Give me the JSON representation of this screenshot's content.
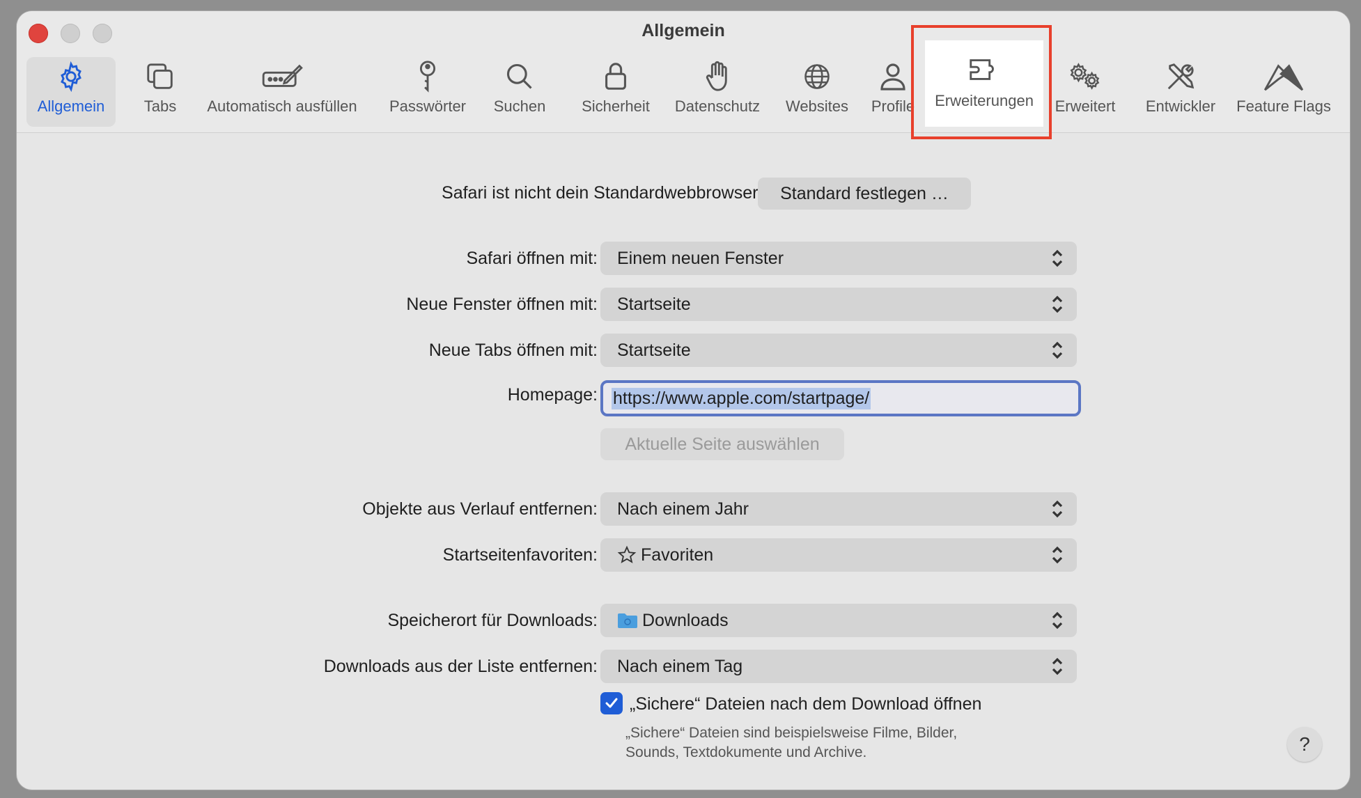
{
  "window": {
    "title": "Allgemein"
  },
  "tabs": [
    {
      "label": "Allgemein",
      "icon": "gear-icon",
      "active": true
    },
    {
      "label": "Tabs",
      "icon": "tabs-icon"
    },
    {
      "label": "Automatisch ausfüllen",
      "icon": "autofill-icon"
    },
    {
      "label": "Passwörter",
      "icon": "key-icon"
    },
    {
      "label": "Suchen",
      "icon": "search-icon"
    },
    {
      "label": "Sicherheit",
      "icon": "lock-icon"
    },
    {
      "label": "Datenschutz",
      "icon": "hand-icon"
    },
    {
      "label": "Websites",
      "icon": "globe-icon"
    },
    {
      "label": "Profile",
      "icon": "person-icon"
    },
    {
      "label": "Erweiterungen",
      "icon": "puzzle-icon",
      "highlighted": true
    },
    {
      "label": "Erweitert",
      "icon": "gears-icon"
    },
    {
      "label": "Entwickler",
      "icon": "tools-icon"
    },
    {
      "label": "Feature Flags",
      "icon": "flags-icon"
    }
  ],
  "default_browser": {
    "message": "Safari ist nicht dein Standardwebbrowser.",
    "button": "Standard festlegen …"
  },
  "settings": {
    "open_with": {
      "label": "Safari öffnen mit:",
      "value": "Einem neuen Fenster"
    },
    "new_windows": {
      "label": "Neue Fenster öffnen mit:",
      "value": "Startseite"
    },
    "new_tabs": {
      "label": "Neue Tabs öffnen mit:",
      "value": "Startseite"
    },
    "homepage": {
      "label": "Homepage:",
      "value": "https://www.apple.com/startpage/"
    },
    "current_page_button": "Aktuelle Seite auswählen",
    "history": {
      "label": "Objekte aus Verlauf entfernen:",
      "value": "Nach einem Jahr"
    },
    "favorites": {
      "label": "Startseitenfavoriten:",
      "value": "Favoriten",
      "icon": "star-icon"
    },
    "download_location": {
      "label": "Speicherort für Downloads:",
      "value": "Downloads",
      "icon": "folder-icon"
    },
    "download_removal": {
      "label": "Downloads aus der Liste entfernen:",
      "value": "Nach einem Tag"
    },
    "safe_files": {
      "label": "„Sichere“ Dateien nach dem Download öffnen",
      "checked": true,
      "description_line1": "„Sichere“ Dateien sind beispielsweise Filme, Bilder,",
      "description_line2": "Sounds, Textdokumente und Archive."
    }
  },
  "help": "?",
  "colors": {
    "accent": "#1f5dd6",
    "highlight_border": "#e8402c",
    "close": "#e0443e"
  }
}
